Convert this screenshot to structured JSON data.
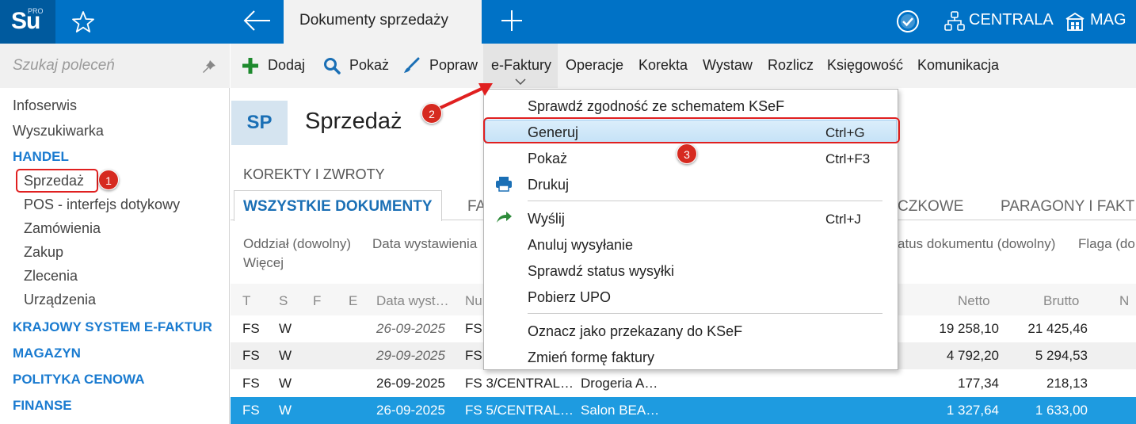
{
  "topbar": {
    "logo": "Su",
    "logo_tag": "PRO",
    "active_tab": "Dokumenty sprzedaży",
    "company": "CENTRALA",
    "warehouse": "MAG"
  },
  "sidebar": {
    "search_placeholder": "Szukaj poleceń",
    "items": [
      {
        "label": "Infoserwis"
      },
      {
        "label": "Wyszukiwarka"
      }
    ],
    "sections": {
      "handel": "HANDEL",
      "ksef": "KRAJOWY SYSTEM E-FAKTUR",
      "magazyn": "MAGAZYN",
      "polityka": "POLITYKA CENOWA",
      "finanse": "FINANSE"
    },
    "handel_items": [
      {
        "label": "Sprzedaż"
      },
      {
        "label": "POS - interfejs dotykowy"
      },
      {
        "label": "Zamówienia"
      },
      {
        "label": "Zakup"
      },
      {
        "label": "Zlecenia"
      },
      {
        "label": "Urządzenia"
      }
    ]
  },
  "toolbar": {
    "add": "Dodaj",
    "show": "Pokaż",
    "edit": "Popraw",
    "efaktury": "e-Faktury",
    "operacje": "Operacje",
    "korekta": "Korekta",
    "wystaw": "Wystaw",
    "rozlicz": "Rozlicz",
    "ksiegowosc": "Księgowość",
    "komunikacja": "Komunikacja"
  },
  "page": {
    "badge": "SP",
    "title": "Sprzedaż",
    "group_label": "KOREKTY I ZWROTY"
  },
  "tabs": {
    "all": "WSZYSTKIE DOKUMENTY",
    "fa_partial": "FA",
    "czkowe_partial": "CZKOWE",
    "paragony_partial": "PARAGONY I FAKT"
  },
  "filters": {
    "oddzial": "Oddział (dowolny)",
    "data": "Data wystawienia",
    "status": "atus dokumentu (dowolny)",
    "flaga": "Flaga (do",
    "wiecej": "Więcej"
  },
  "grid": {
    "headers": {
      "t": "T",
      "s": "S",
      "f": "F",
      "e": "E",
      "date": "Data wyst…",
      "nu": "Nu",
      "netto": "Netto",
      "brutto": "Brutto",
      "n": "N"
    },
    "rows": [
      {
        "t": "FS",
        "s": "W",
        "date": "26-09-2025",
        "number": "FS",
        "client": "",
        "netto": "19 258,10",
        "brutto": "21 425,46"
      },
      {
        "t": "FS",
        "s": "W",
        "date": "29-09-2025",
        "number": "FS",
        "client": "",
        "netto": "4 792,20",
        "brutto": "5 294,53"
      },
      {
        "t": "FS",
        "s": "W",
        "date": "26-09-2025",
        "number": "FS 3/CENTRAL…",
        "client": "Drogeria A…",
        "netto": "177,34",
        "brutto": "218,13"
      },
      {
        "t": "FS",
        "s": "W",
        "date": "26-09-2025",
        "number": "FS 5/CENTRAL…",
        "client": "Salon BEA…",
        "netto": "1 327,64",
        "brutto": "1 633,00"
      }
    ]
  },
  "menu": {
    "items": [
      {
        "label": "Sprawdź zgodność ze schematem KSeF",
        "shortcut": ""
      },
      {
        "label": "Generuj",
        "shortcut": "Ctrl+G"
      },
      {
        "label": "Pokaż",
        "shortcut": "Ctrl+F3"
      },
      {
        "label": "Drukuj",
        "shortcut": ""
      },
      {
        "label": "Wyślij",
        "shortcut": "Ctrl+J"
      },
      {
        "label": "Anuluj wysyłanie",
        "shortcut": ""
      },
      {
        "label": "Sprawdź status wysyłki",
        "shortcut": ""
      },
      {
        "label": "Pobierz UPO",
        "shortcut": ""
      },
      {
        "label": "Oznacz jako przekazany do KSeF",
        "shortcut": ""
      },
      {
        "label": "Zmień formę faktury",
        "shortcut": ""
      }
    ]
  },
  "callouts": {
    "one": "1",
    "two": "2",
    "three": "3"
  },
  "colors": {
    "brand": "#0072c6",
    "brand_dark": "#005a9e",
    "section": "#1a7bd0",
    "selection": "#1e9be0",
    "annotation": "#e02020"
  },
  "icons": [
    "star-icon",
    "back-arrow-icon",
    "plus-icon",
    "check-circle-icon",
    "network-icon",
    "warehouse-icon",
    "pin-icon",
    "add-icon",
    "search-icon",
    "brush-icon",
    "chevron-down-icon",
    "printer-icon",
    "send-arrow-icon"
  ]
}
